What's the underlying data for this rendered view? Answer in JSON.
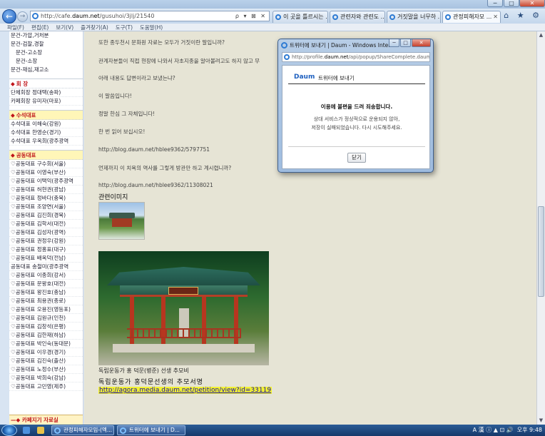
{
  "browser": {
    "address_prefix": "http://cafe.",
    "address_host": "daum.net",
    "address_rest": "/gusuhoi/3jlj/21540",
    "address_controls": "ρ ▾ ⊠ ✕",
    "tabs": [
      {
        "label": "이 곳을 틀르시는 ..."
      },
      {
        "label": "관련자와 관련도 ..."
      },
      {
        "label": "거짓말을 너무하 ..."
      },
      {
        "label": "관정피해자모 ..."
      }
    ],
    "toolbar_icons": "⌂ ★ ⚙",
    "window_controls": {
      "minimize": "─",
      "maximize": "□",
      "close": "✕"
    },
    "menu": [
      "파일(F)",
      "편집(E)",
      "보기(V)",
      "즐겨찾기(A)",
      "도구(T)",
      "도움말(H)"
    ]
  },
  "sidebar": {
    "top_items": [
      "문건-가압,거처분",
      "문건-검찰,경찰",
      "문건-고소장",
      "문건-소장",
      "문건-재심,재고소"
    ],
    "sections": [
      {
        "title": "회 장",
        "items": [
          "단체회장 정대택(송파)",
          "카페회장 유미자(마포)"
        ]
      },
      {
        "title": "수석대표",
        "items": [
          "수석대표 이해숙(강원)",
          "수석대표 한영순(경기)",
          "수석대표 우옥희(광주광역"
        ]
      },
      {
        "title": "공동대표",
        "items": [
          "♡공동대표 구수회(서울)",
          "♡공동대표 이영숙(부산)",
          "♡공동대표 이택익(광주광역",
          "♡공동대표 허현권(광남)",
          "♡공동대표 정바다(충북)",
          "♡공동대표 조양연(서울)",
          "♡공동대표 김진희(경북)",
          "♡공동대표 김학서(대전)",
          "♡공동대표 김성자(광역)",
          "♡공동대표 권정우(강원)",
          "♡공동대표 정홍표(대구)",
          "♡공동대표 배옥덕(전남)",
          "공동대표 송철미(광주광역",
          "♡공동대표 이종희(강서)",
          "♡공동대표 문왕호(대전)",
          "♡공동대표 왕진호(충남)",
          "♡공동대표 최용권(종로)",
          "♡공동대표 오용진(영등포)",
          "♡공동대표 김원규(인천)",
          "♡공동대표 김창석(은평)",
          "♡공동대표 김한재(하남)",
          "♡공동대표 박인숙(동대문)",
          "♡공동대표 이우경(경기)",
          "♡공동대표 김진숙(출산)",
          "♡공동대표 노정수(부산)",
          "♡공동대표 박희숙(강남)",
          "♡공동대표 고민영(제주)"
        ]
      }
    ],
    "bottom": "카페지기 자료실"
  },
  "content": {
    "lines": [
      "또한 종두천시 문화원 자료는 모두가 거짓이란 말입니까?",
      "관계자분들이 직접 현장에 나와서 자초지종을 알아볼려고도 하지 않고 무",
      "아래 내용도 답변이라고 보냈는냐?",
      "이 말씀입니다!",
      "정말 한심 그 자체입니다!",
      "한 번 읽어 보십시오!",
      "http://blog.daum.net/hblee9362/5797751",
      "언제까지 이 치욕의 역사를 그렇게 방관만 하고 계시렵니까?",
      "http://blog.daum.net/hblee9362/11308021"
    ],
    "related_title": "관련이미지",
    "caption": "독립운동가 홍 덕문(병준) 선생 추모비",
    "caption2": "독립운동가 홍덕문선생의 추모서명",
    "petition_url": "http://agora.media.daum.net/petition/view?id=33119"
  },
  "popup": {
    "title": "트위터에 보내기 | Daum - Windows Inter...",
    "address_prefix": "http://profile.",
    "address_host": "daum.net",
    "address_rest": "/api/popup/ShareComplete.daum",
    "logo": "Daum",
    "heading": "트위터에 보내기",
    "message_bold": "이용에 불편을 드려 죄송합니다.",
    "message_line1": "상대 서비스가 정상적으로 운용되지 않아,",
    "message_line2": "저장이 실패되었습니다. 다시 시도해주세요.",
    "ok_label": "닫기"
  },
  "taskbar": {
    "tasks": [
      "관정피해자모임-(엑...",
      "트위터에 보내기 | D..."
    ],
    "tray_text": "A 漢 ⓘ ▲ ⊡ 🔊",
    "clock": "오후 9:48"
  }
}
